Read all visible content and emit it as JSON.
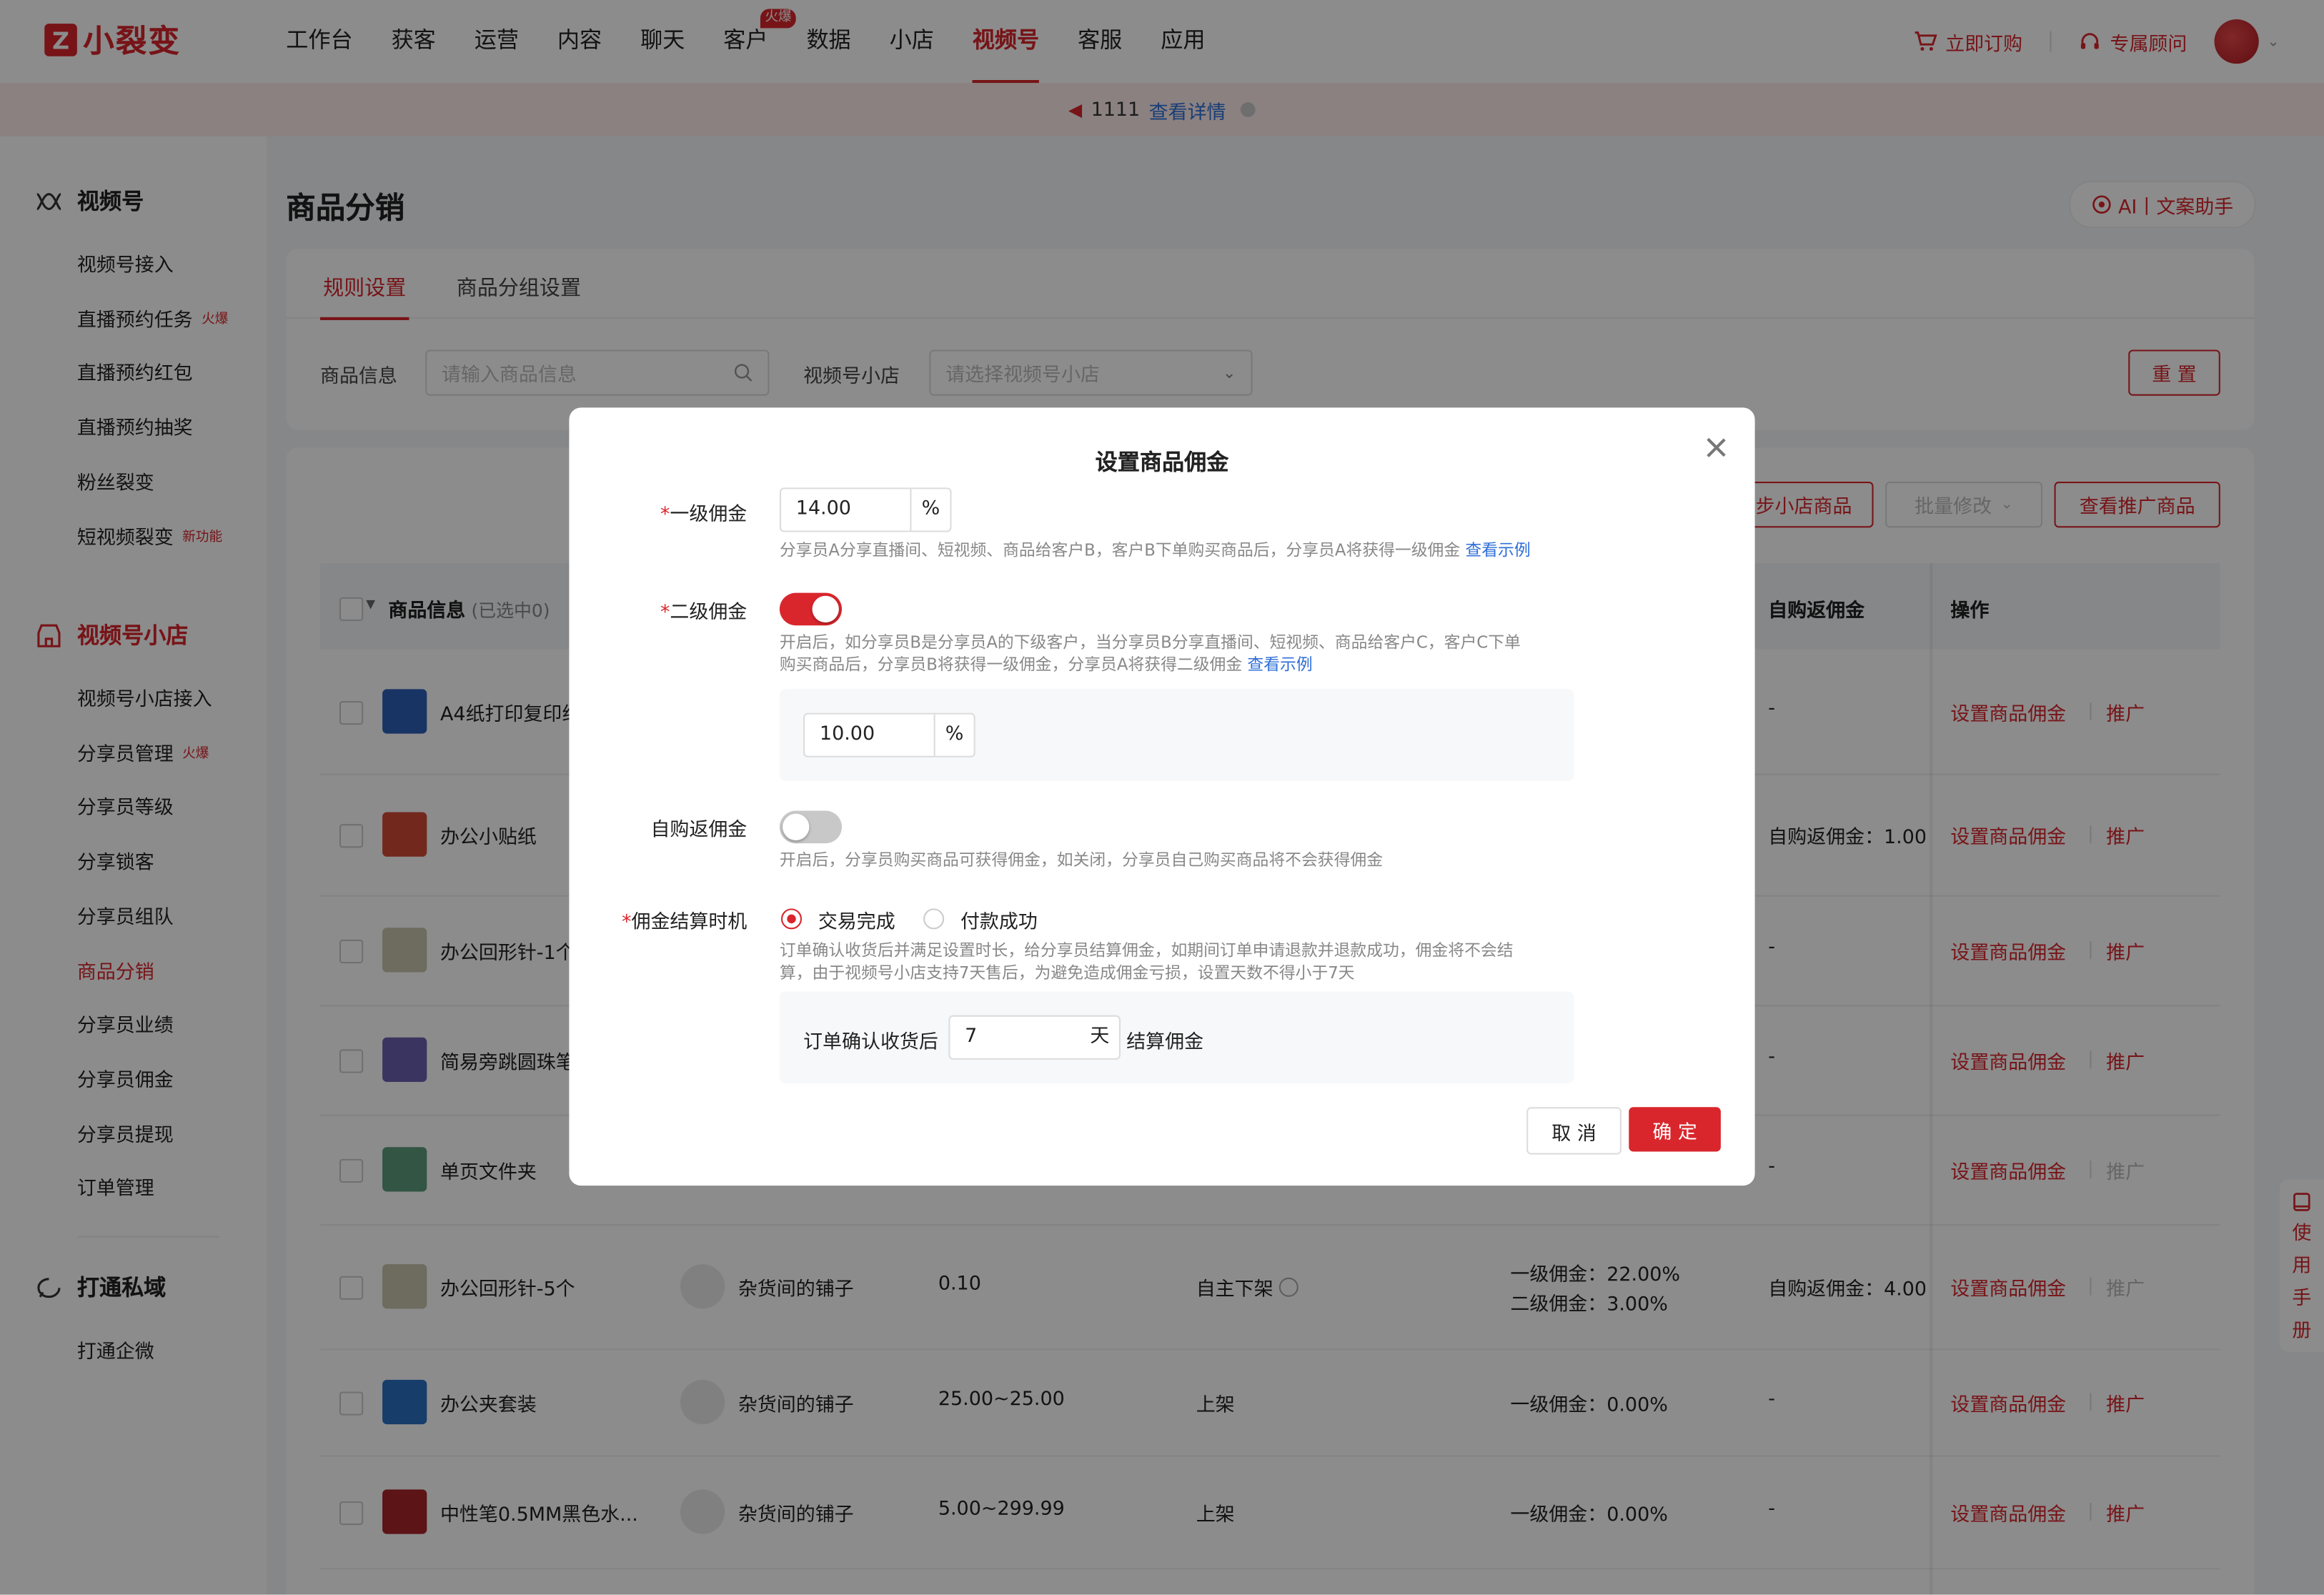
{
  "app": {
    "logo_text": "小裂变",
    "nav": [
      "工作台",
      "获客",
      "运营",
      "内容",
      "聊天",
      "客户",
      "数据",
      "小店",
      "视频号",
      "客服",
      "应用"
    ],
    "nav_active_index": 8,
    "nav_hot_tag": "火爆",
    "subscribe_label": "立即订购",
    "advisor_label": "专属顾问",
    "brand_color": "#d9262c"
  },
  "notice": {
    "text": "1111",
    "link": "查看详情"
  },
  "sidebar": {
    "group1": "视频号",
    "group1_items": [
      {
        "label": "视频号接入",
        "tag": ""
      },
      {
        "label": "直播预约任务",
        "tag": "火爆"
      },
      {
        "label": "直播预约红包",
        "tag": ""
      },
      {
        "label": "直播预约抽奖",
        "tag": ""
      },
      {
        "label": "粉丝裂变",
        "tag": ""
      },
      {
        "label": "短视频裂变",
        "tag": "新功能"
      }
    ],
    "group2": "视频号小店",
    "group2_items": [
      {
        "label": "视频号小店接入",
        "tag": ""
      },
      {
        "label": "分享员管理",
        "tag": "火爆"
      },
      {
        "label": "分享员等级",
        "tag": ""
      },
      {
        "label": "分享锁客",
        "tag": ""
      },
      {
        "label": "分享员组队",
        "tag": ""
      },
      {
        "label": "商品分销",
        "tag": ""
      },
      {
        "label": "分享员业绩",
        "tag": ""
      },
      {
        "label": "分享员佣金",
        "tag": ""
      },
      {
        "label": "分享员提现",
        "tag": ""
      },
      {
        "label": "订单管理",
        "tag": ""
      }
    ],
    "group3": "打通私域",
    "group3_items": [
      {
        "label": "打通企微",
        "tag": ""
      }
    ]
  },
  "page": {
    "title": "商品分销",
    "ai_button": "AI丨文案助手",
    "tabs": [
      "规则设置",
      "商品分组设置"
    ],
    "filter_product_label": "商品信息",
    "filter_product_placeholder": "请输入商品信息",
    "filter_shop_label": "视频号小店",
    "filter_shop_placeholder": "请选择视频号小店",
    "reset_button": "重 置",
    "sync_button": "步小店商品",
    "batch_button": "批量修改",
    "view_promo_button": "查看推广商品"
  },
  "table": {
    "headers": {
      "product": "商品信息",
      "selected": "(已选中0)",
      "self_commission": "自购返佣金",
      "ops": "操作"
    },
    "op_set": "设置商品佣金",
    "op_promote": "推广",
    "rows": [
      {
        "name": "A4纸打印复印纸",
        "shop": "",
        "price": "",
        "status": "",
        "commission": [
          "-"
        ],
        "self": "-",
        "promote_enabled": true,
        "thumb": "#2d5fb8"
      },
      {
        "name": "办公小贴纸",
        "shop": "",
        "price": "",
        "status": "",
        "commission": [
          ""
        ],
        "self": "自购返佣金：1.00%",
        "promote_enabled": true,
        "thumb": "#d24a35"
      },
      {
        "name": "办公回形针-1个",
        "shop": "",
        "price": "",
        "status": "",
        "commission": [
          ""
        ],
        "self": "-",
        "promote_enabled": true,
        "thumb": "#c9c4ad"
      },
      {
        "name": "简易旁跳圆珠笔",
        "shop": "",
        "price": "",
        "status": "",
        "commission": [
          ""
        ],
        "self": "-",
        "promote_enabled": true,
        "thumb": "#6a5fb0"
      },
      {
        "name": "单页文件夹",
        "shop": "",
        "price": "",
        "status": "",
        "commission": [
          ""
        ],
        "self": "-",
        "promote_enabled": false,
        "thumb": "#5b9c7c"
      },
      {
        "name": "办公回形针-5个",
        "shop": "杂货间的铺子",
        "price": "0.10",
        "status": "自主下架",
        "commission": [
          "一级佣金：22.00%",
          "二级佣金：3.00%"
        ],
        "self": "自购返佣金：4.00%",
        "promote_enabled": false,
        "thumb": "#c9c4ad"
      },
      {
        "name": "办公夹套装",
        "shop": "杂货间的铺子",
        "price": "25.00~25.00",
        "status": "上架",
        "commission": [
          "一级佣金：0.00%"
        ],
        "self": "-",
        "promote_enabled": true,
        "thumb": "#2a6fc4"
      },
      {
        "name": "中性笔0.5MM黑色水...",
        "shop": "杂货间的铺子",
        "price": "5.00~299.99",
        "status": "上架",
        "commission": [
          "一级佣金：0.00%"
        ],
        "self": "-",
        "promote_enabled": true,
        "thumb": "#a8262b"
      }
    ]
  },
  "modal": {
    "title": "设置商品佣金",
    "level1_label": "一级佣金",
    "level1_value": "14.00",
    "unit_percent": "%",
    "level1_help": "分享员A分享直播间、短视频、商品给客户B，客户B下单购买商品后，分享员A将获得一级佣金",
    "view_example": "查看示例",
    "level2_label": "二级佣金",
    "level2_enabled": true,
    "level2_help_line1": "开启后，如分享员B是分享员A的下级客户，当分享员B分享直播间、短视频、商品给客户C，客户C下单",
    "level2_help_line2": "购买商品后，分享员B将获得一级佣金，分享员A将获得二级佣金",
    "level2_value": "10.00",
    "self_label": "自购返佣金",
    "self_enabled": false,
    "self_help": "开启后，分享员购买商品可获得佣金，如关闭，分享员自己购买商品将不会获得佣金",
    "timing_label": "佣金结算时机",
    "timing_options": [
      "交易完成",
      "付款成功"
    ],
    "timing_selected": 0,
    "timing_help_line1": "订单确认收货后并满足设置时长，给分享员结算佣金，如期间订单申请退款并退款成功，佣金将不会结",
    "timing_help_line2": "算，由于视频号小店支持7天售后，为避免造成佣金亏损，设置天数不得小于7天",
    "days_prefix": "订单确认收货后",
    "days_value": "7",
    "days_unit": "天",
    "days_suffix": "结算佣金",
    "cancel": "取 消",
    "confirm": "确 定"
  },
  "manual_tab": [
    "使",
    "用",
    "手",
    "册"
  ]
}
